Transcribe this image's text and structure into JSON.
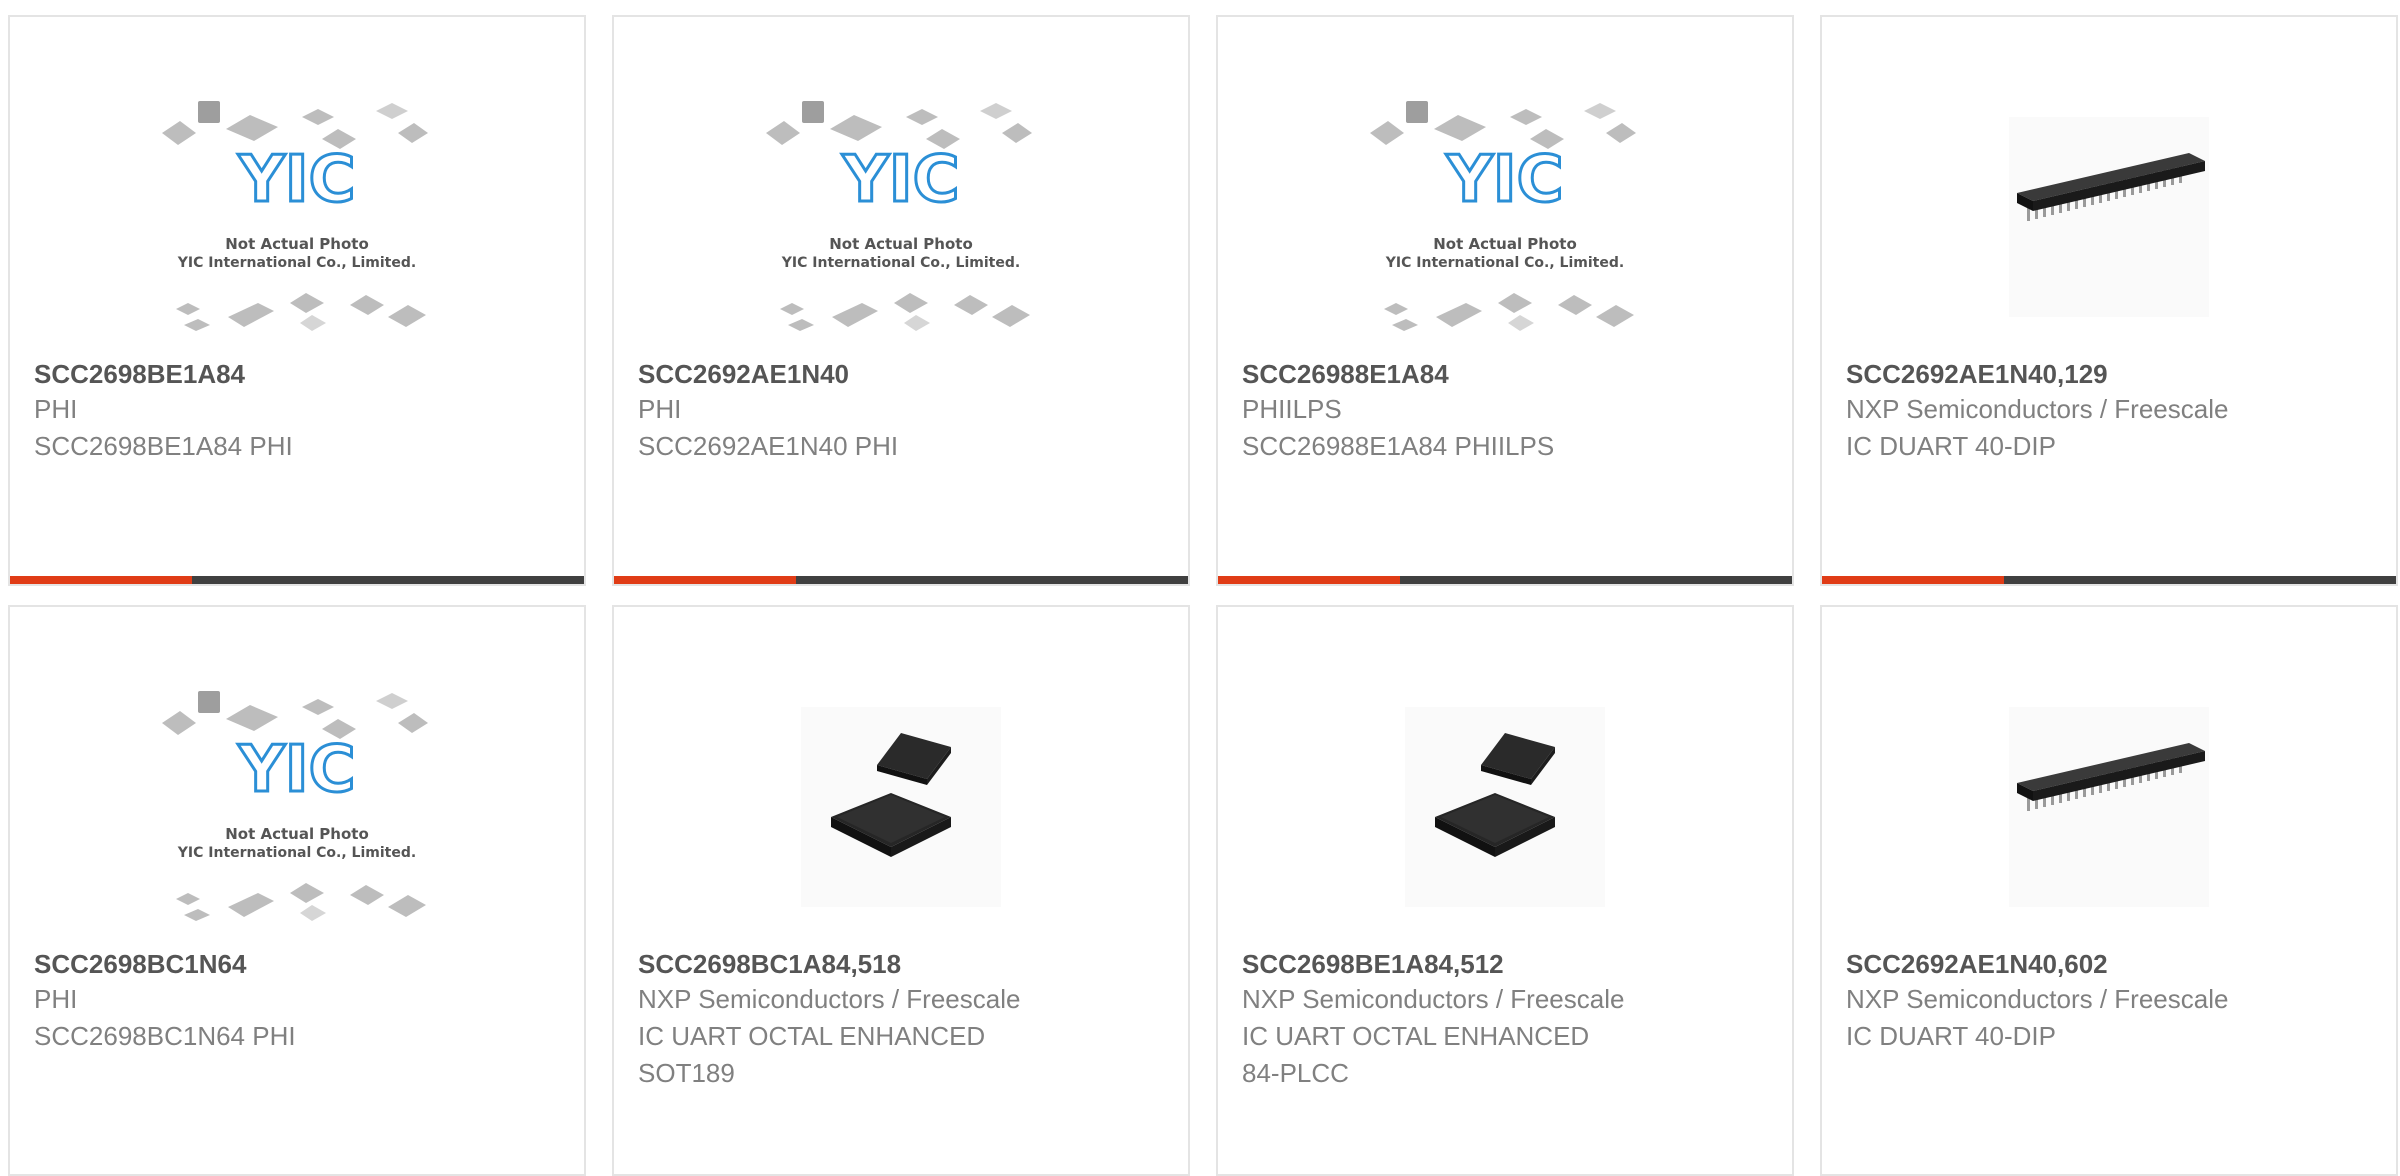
{
  "placeholder_image": {
    "logo_text": "YIC",
    "line1": "Not Actual Photo",
    "line2": "YIC International Co., Limited."
  },
  "colors": {
    "accent": "#e03c16",
    "bar_dark": "#404040",
    "logo_blue": "#2b8fd6",
    "part_text": "#555555",
    "secondary_text": "#808080"
  },
  "products": [
    {
      "part": "SCC2698BE1A84",
      "manufacturer": "PHI",
      "description": "SCC2698BE1A84 PHI",
      "description2": "",
      "image": "placeholder-icon"
    },
    {
      "part": "SCC2692AE1N40",
      "manufacturer": "PHI",
      "description": "SCC2692AE1N40 PHI",
      "description2": "",
      "image": "placeholder-icon"
    },
    {
      "part": "SCC26988E1A84",
      "manufacturer": "PHIILPS",
      "description": "SCC26988E1A84 PHIILPS",
      "description2": "",
      "image": "placeholder-icon"
    },
    {
      "part": "SCC2692AE1N40,129",
      "manufacturer": "NXP Semiconductors / Freescale",
      "description": "IC DUART 40-DIP",
      "description2": "",
      "image": "dip-chip-icon"
    },
    {
      "part": "SCC2698BC1N64",
      "manufacturer": "PHI",
      "description": "SCC2698BC1N64 PHI",
      "description2": "",
      "image": "placeholder-icon"
    },
    {
      "part": "SCC2698BC1A84,518",
      "manufacturer": "NXP Semiconductors / Freescale",
      "description": "IC UART OCTAL ENHANCED",
      "description2": "SOT189",
      "image": "plcc-chip-icon"
    },
    {
      "part": "SCC2698BE1A84,512",
      "manufacturer": "NXP Semiconductors / Freescale",
      "description": "IC UART OCTAL ENHANCED",
      "description2": "84-PLCC",
      "image": "plcc-chip-icon"
    },
    {
      "part": "SCC2692AE1N40,602",
      "manufacturer": "NXP Semiconductors / Freescale",
      "description": "IC DUART 40-DIP",
      "description2": "",
      "image": "dip-chip-icon"
    }
  ]
}
